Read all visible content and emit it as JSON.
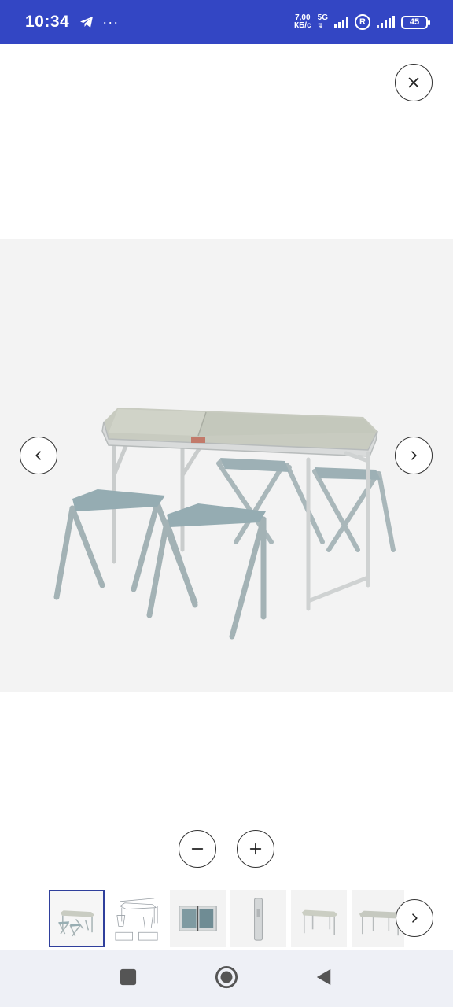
{
  "status_bar": {
    "time": "10:34",
    "dots": "···",
    "net_speed_value": "7,00",
    "net_speed_unit": "КБ/с",
    "network_type": "5G",
    "roaming": "R",
    "battery": "45",
    "icons": [
      "telegram-icon",
      "signal-icon",
      "roaming-icon",
      "battery-icon"
    ],
    "background_color": "#3346c4"
  },
  "viewer": {
    "close_icon": "close-icon",
    "prev_icon": "chevron-left-icon",
    "next_icon": "chevron-right-icon",
    "image_description": "folding-table-with-four-stools"
  },
  "zoom": {
    "out_icon": "minus-icon",
    "in_icon": "plus-icon"
  },
  "thumbnails": {
    "count_visible": 6,
    "active_index": 0,
    "next_icon": "chevron-right-icon",
    "active_border_color": "#2f3f9c"
  },
  "system_nav": {
    "icons": [
      "recents-icon",
      "home-icon",
      "back-icon"
    ],
    "background_color": "#eef0f6"
  }
}
